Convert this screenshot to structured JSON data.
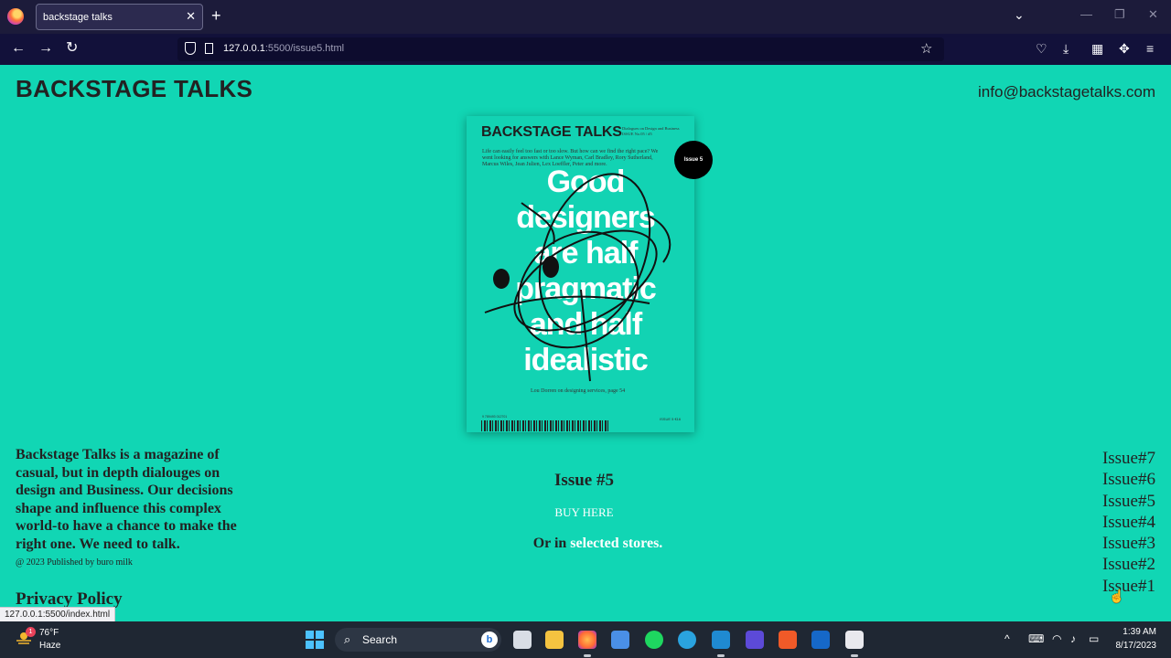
{
  "browser": {
    "tab_title": "backstage talks",
    "url_host": "127.0.0.1",
    "url_rest": ":5500/issue5.html",
    "status_link": "127.0.0.1:5500/index.html"
  },
  "header": {
    "title": "BACKSTAGE TALKS",
    "email": "info@backstagetalks.com"
  },
  "cover": {
    "title": "BACKSTAGE TALKS",
    "small_text": "Dialogues on Design and Business ISSUE No.05 / #5",
    "intro": "Life can easily feel too fast or too slow. But how can we find the right pace? We went looking for answers with Lance Wyman, Carl Bradley, Rory Sutherland, Marcus Wiles, Jean Julien, Lex Loeffler, Peter and more.",
    "headline": [
      "Good",
      "designers",
      "are half",
      "pragmatic",
      "and half",
      "idealistic"
    ],
    "caption": "Lou Dorren on designing services, page 54",
    "barcode_number": "9 789493 012701",
    "footer_right": "ISSUE 5  €16",
    "badge": "Issue 5"
  },
  "about": {
    "text": "Backstage Talks is a magazine of casual, but in depth dialouges on design and Business. Our decisions shape and influence this complex world-to have a chance to make the right one. We need to talk.",
    "published": "@ 2023 Published by buro milk",
    "privacy": "Privacy Policy"
  },
  "issue": {
    "heading": "Issue #5",
    "buy_label": "BUY HERE",
    "stores_prefix": "Or in",
    "stores_link": "selected stores."
  },
  "issues_list": [
    "Issue#7",
    "Issue#6",
    "Issue#5",
    "Issue#4",
    "Issue#3",
    "Issue#2",
    "Issue#1"
  ],
  "taskbar": {
    "temperature": "76°F",
    "weather": "Haze",
    "weather_badge": "1",
    "search_label": "Search",
    "time": "1:39 AM",
    "date": "8/17/2023"
  },
  "colors": {
    "page_background": "#11d6b4",
    "text": "#222222",
    "link": "#ffffff",
    "browser_chrome": "#1c1b3a"
  }
}
